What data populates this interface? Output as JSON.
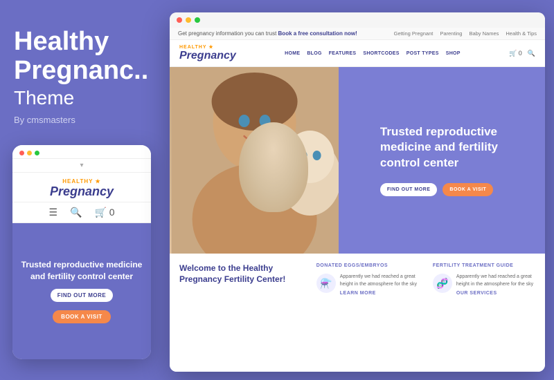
{
  "left_panel": {
    "title_line1": "Healthy",
    "title_line2": "Pregnanc..",
    "subtitle": "Theme",
    "by": "By cmsmasters"
  },
  "mobile": {
    "logo_healthy": "HEALTHY",
    "logo_star": "★",
    "logo_pregnancy": "Pregnancy",
    "hero_text": "Trusted reproductive medicine and fertility control center",
    "btn_find": "FIND OUT MORE",
    "btn_book": "BOOK A VISIT"
  },
  "desktop": {
    "announce_text": "Get pregnancy information you can trust",
    "announce_link": "Book a free consultation now!",
    "announce_links": [
      "Getting Pregnant",
      "Parenting",
      "Baby Names",
      "Health & Tips"
    ],
    "nav_links": [
      "HOME",
      "BLOG",
      "FEATURES",
      "SHORTCODES",
      "POST TYPES",
      "SHOP"
    ],
    "logo_healthy": "HEALTHY",
    "logo_pregnancy": "Pregnancy",
    "hero_heading": "Trusted reproductive medicine and fertility control center",
    "btn_find": "FIND OUT MORE",
    "btn_book": "BOOK A VISIT",
    "info_left_title": "Welcome to the Healthy Pregnancy Fertility Center!",
    "col1_header": "DONATED EGGS/EMBRYOS",
    "col1_text": "Apparently we had reached a great height in the atmosphere for the sky",
    "col1_link": "LEARN MORE",
    "col2_header": "FERTILITY TREATMENT GUIDE",
    "col2_text": "Apparently we had reached a great height in the atmosphere for the sky",
    "col2_link": "OUR SERVICES"
  },
  "colors": {
    "purple": "#6b6ec4",
    "dark_blue": "#3b3d8e",
    "orange": "#f5884a",
    "white": "#ffffff"
  }
}
